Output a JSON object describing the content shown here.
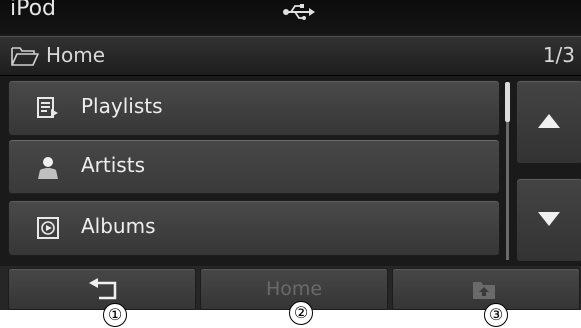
{
  "title": "iPod",
  "path": {
    "label": "Home",
    "page": "1/3"
  },
  "list": [
    {
      "label": "Playlists",
      "icon": "playlist-icon"
    },
    {
      "label": "Artists",
      "icon": "artist-icon"
    },
    {
      "label": "Albums",
      "icon": "album-icon"
    }
  ],
  "scroll": {
    "up_icon": "arrow-up-icon",
    "down_icon": "arrow-down-icon",
    "position": 0.0
  },
  "bottom": {
    "back_icon": "back-return-icon",
    "home_label": "Home",
    "up_icon": "folder-up-icon"
  },
  "callouts": [
    "①",
    "②",
    "③"
  ],
  "colors": {
    "background": "#1a1a1a",
    "item": "#3e3e3e",
    "text": "#eeeeee",
    "disabled_text": "#6a6a6a"
  }
}
